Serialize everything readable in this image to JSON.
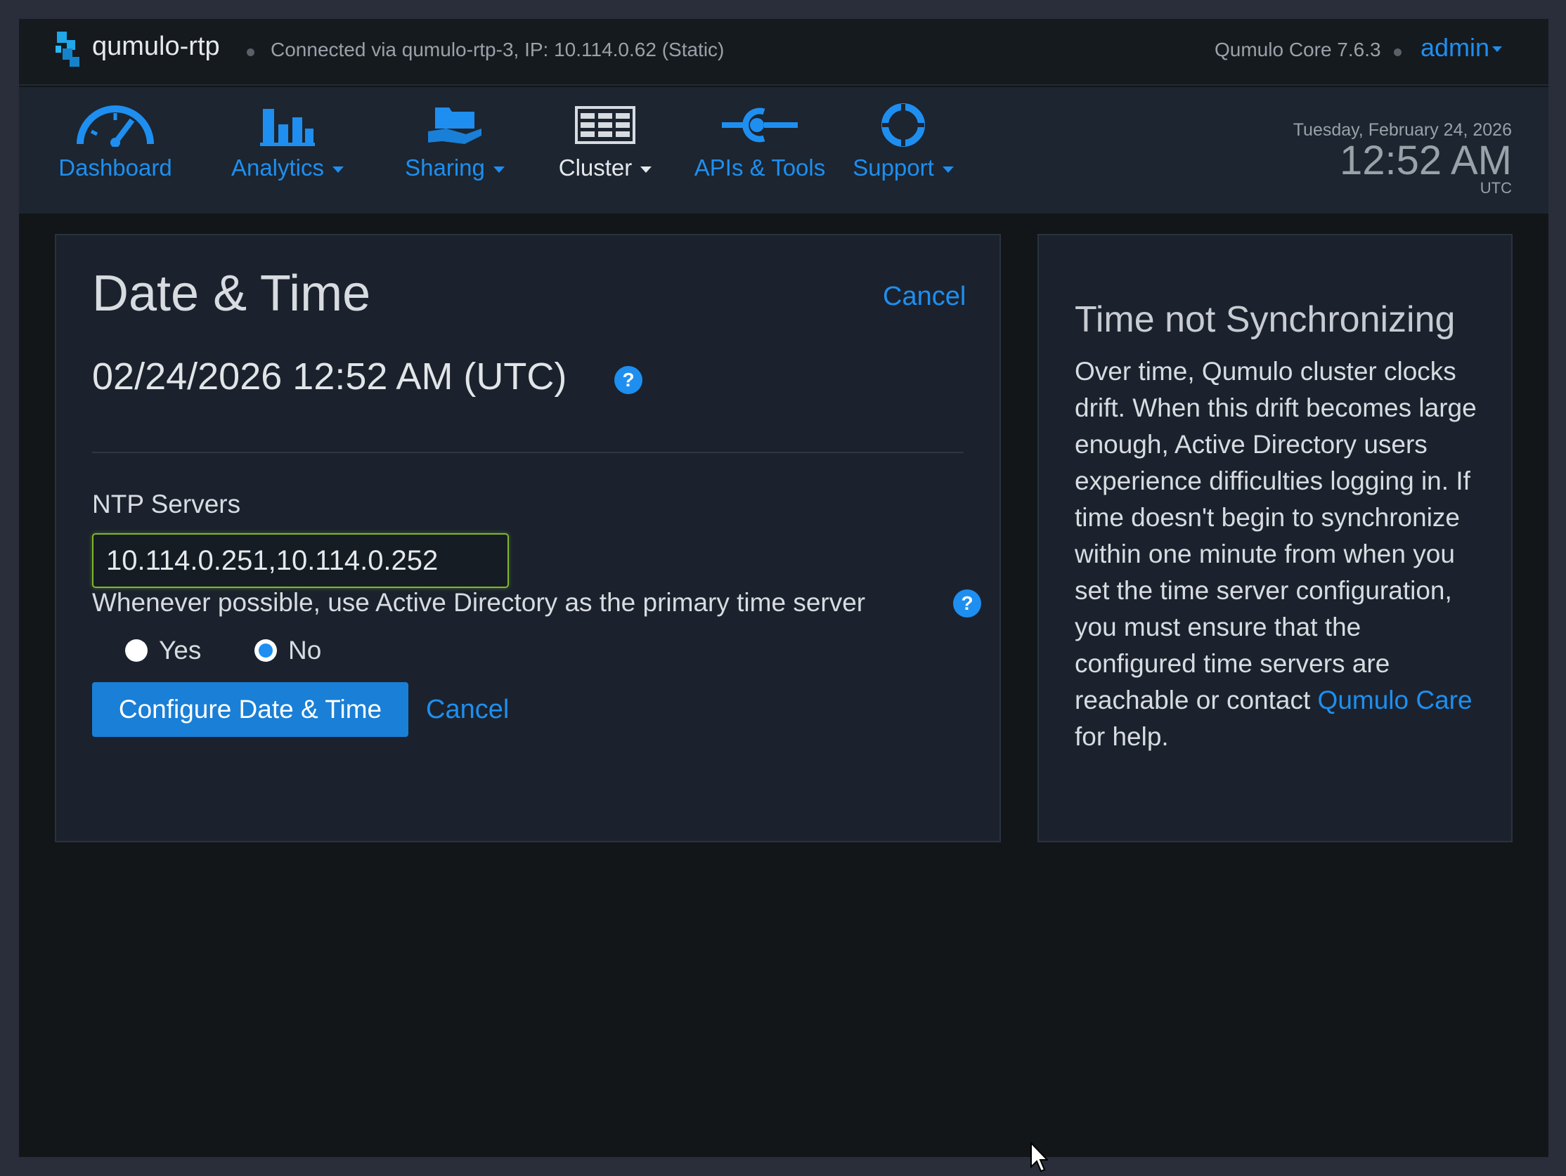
{
  "topbar": {
    "cluster_name": "qumulo-rtp",
    "connection_info": "Connected via qumulo-rtp-3, IP: 10.114.0.62 (Static)",
    "version": "Qumulo Core 7.6.3",
    "user": "admin"
  },
  "nav": {
    "items": [
      {
        "label": "Dashboard",
        "icon": "speedometer-icon"
      },
      {
        "label": "Analytics",
        "icon": "bar-chart-icon"
      },
      {
        "label": "Sharing",
        "icon": "folder-hand-icon"
      },
      {
        "label": "Cluster",
        "icon": "server-rack-icon"
      },
      {
        "label": "APIs & Tools",
        "icon": "api-connector-icon"
      },
      {
        "label": "Support",
        "icon": "lifebuoy-icon"
      }
    ],
    "active": "Cluster"
  },
  "clock": {
    "day": "Tuesday, February 24, 2026",
    "time": "12:52 AM",
    "timezone": "UTC"
  },
  "main": {
    "title": "Date & Time",
    "cancel_top": "Cancel",
    "current_datetime": "02/24/2026 12:52 AM (UTC)",
    "ntp_label": "NTP Servers",
    "ntp_value": "10.114.0.251,10.114.0.252",
    "ad_question": "Whenever possible, use Active Directory as the primary time server",
    "radio_yes": "Yes",
    "radio_no": "No",
    "selected_option": "No",
    "configure_button": "Configure Date & Time",
    "cancel_bottom": "Cancel"
  },
  "side": {
    "title": "Time not Synchronizing",
    "body": "Over time, Qumulo cluster clocks drift. When this drift becomes large enough, Active Directory users experience difficulties logging in. If time doesn't begin to synchronize within one minute from when you set the time server configuration, you must ensure that the configured time servers are reachable or contact",
    "link_text": "Qumulo Care",
    "body_end": "for help."
  },
  "colors": {
    "accent": "#1e8ff0",
    "background": "#121619",
    "panel": "#1b222d",
    "input_focus_border": "#7fb82a"
  }
}
